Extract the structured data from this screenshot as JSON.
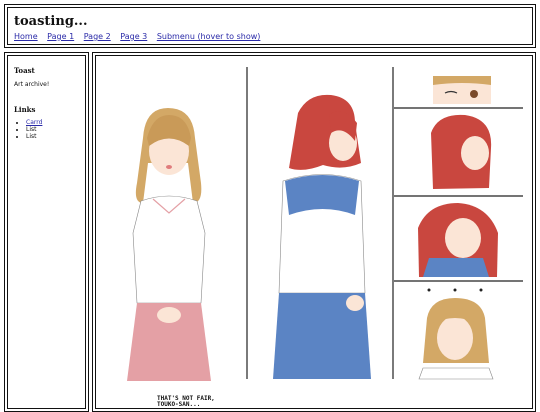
{
  "site": {
    "title": "toasting..."
  },
  "nav": {
    "items": [
      "Home",
      "Page 1",
      "Page 2",
      "Page 3",
      "Submenu (hover to show)"
    ]
  },
  "sidebar": {
    "toast": {
      "title": "Toast",
      "text": "Art archive!"
    },
    "links": {
      "title": "Links",
      "items": [
        "Carrd",
        "List",
        "List"
      ]
    }
  },
  "artwork": {
    "caption_line1": "THAT'S NOT FAIR,",
    "caption_line2": "TOUKO-SAN...",
    "colors": {
      "hair_blonde": "#d3a866",
      "hair_red": "#c9473f",
      "uniform_blue": "#5b84c4",
      "skirt_pink": "#e4a0a5"
    }
  }
}
